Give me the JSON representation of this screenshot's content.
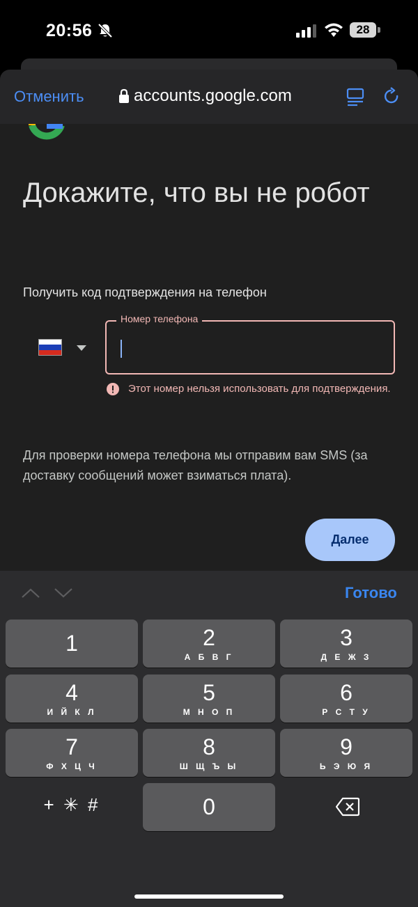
{
  "status_bar": {
    "time": "20:56",
    "battery": "28"
  },
  "browser": {
    "cancel_label": "Отменить",
    "url": "accounts.google.com"
  },
  "page": {
    "headline": "Докажите, что вы не робот",
    "subtitle": "Получить код подтверждения на телефон",
    "country_flag": "russia-flag",
    "phone_field": {
      "label": "Номер телефона",
      "value": ""
    },
    "error": "Этот номер нельзя использовать для подтверждения.",
    "info": "Для проверки номера телефона мы отправим вам SMS (за доставку сообщений может взиматься плата).",
    "next_label": "Далее"
  },
  "keyboard": {
    "done_label": "Готово",
    "keys": [
      {
        "digit": "1",
        "letters": ""
      },
      {
        "digit": "2",
        "letters": "А Б В Г"
      },
      {
        "digit": "3",
        "letters": "Д Е Ж З"
      },
      {
        "digit": "4",
        "letters": "И Й К Л"
      },
      {
        "digit": "5",
        "letters": "М Н О П"
      },
      {
        "digit": "6",
        "letters": "Р С Т У"
      },
      {
        "digit": "7",
        "letters": "Ф Х Ц Ч"
      },
      {
        "digit": "8",
        "letters": "Ш Щ Ъ Ы"
      },
      {
        "digit": "9",
        "letters": "Ь Э Ю Я"
      },
      {
        "digit": "0",
        "letters": ""
      }
    ],
    "symbols_label": "+ ✳ #"
  },
  "colors": {
    "accent": "#4c8ef5",
    "error": "#f2b8b5",
    "button_bg": "#a8c7fa",
    "button_text": "#062e6f"
  }
}
